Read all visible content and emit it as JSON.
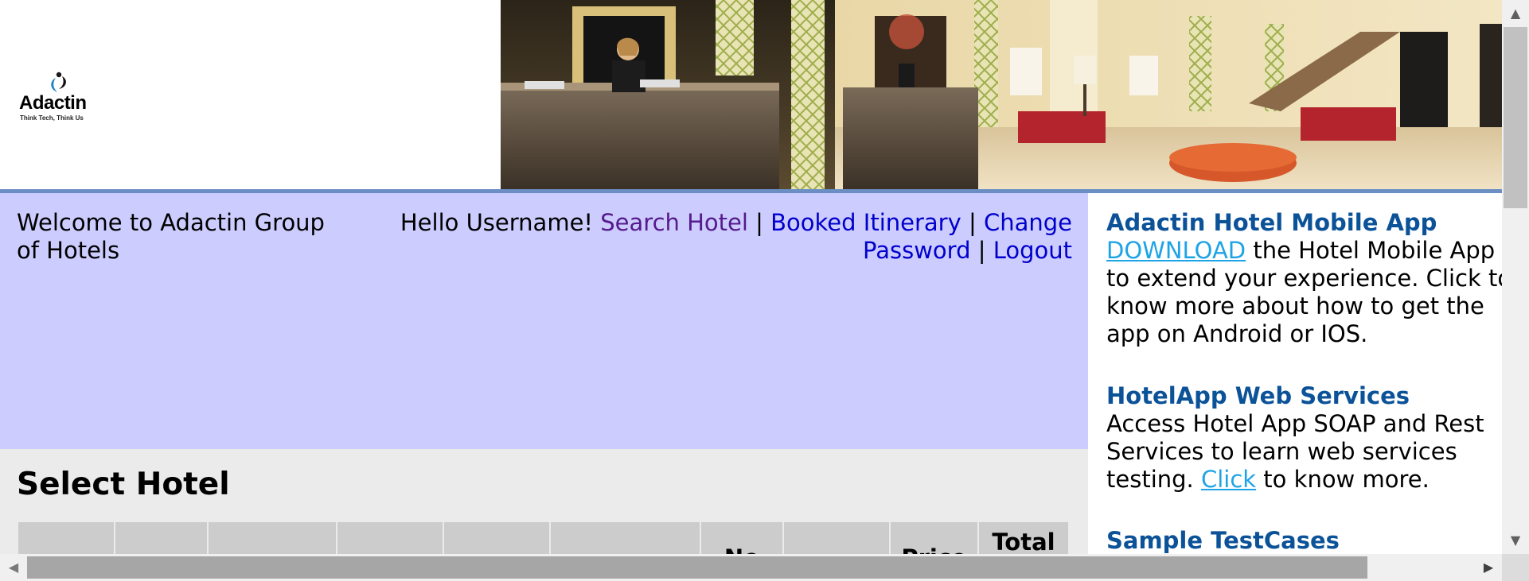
{
  "logo": {
    "name": "Adactin",
    "tagline": "Think Tech, Think Us"
  },
  "banner": {
    "icon": "hotel-lobby-image"
  },
  "welcome": {
    "text": "Welcome to Adactin Group of Hotels"
  },
  "nav": {
    "greeting": "Hello Username!",
    "search_hotel": "Search Hotel",
    "booked_itinerary": "Booked Itinerary",
    "change_password": "Change Password",
    "logout": "Logout",
    "separator": "|"
  },
  "main": {
    "title": "Select Hotel",
    "table_headers": [
      "",
      "",
      "",
      "",
      "",
      "",
      "No",
      "",
      "Price",
      "Total"
    ]
  },
  "sidebar": {
    "mobile_app": {
      "title": "Adactin Hotel Mobile App",
      "link": "DOWNLOAD",
      "text": " the Hotel Mobile App to extend your experience. Click to know more about how to get the app on Android or IOS."
    },
    "web_services": {
      "title": "HotelApp Web Services",
      "text": "Access Hotel App SOAP and Rest Services to learn web services testing. ",
      "link": "Click",
      "text_after": " to know more."
    },
    "testcases": {
      "title": "Sample TestCases"
    }
  },
  "colors": {
    "welcome_bg": "#ccccff",
    "content_bg": "#ebebeb",
    "link": "#0000cc",
    "visited_link": "#551a8b",
    "sidebar_title": "#0b5298",
    "sidebar_link": "#1ea4e6",
    "accent_bar": "#6b8fc4"
  }
}
